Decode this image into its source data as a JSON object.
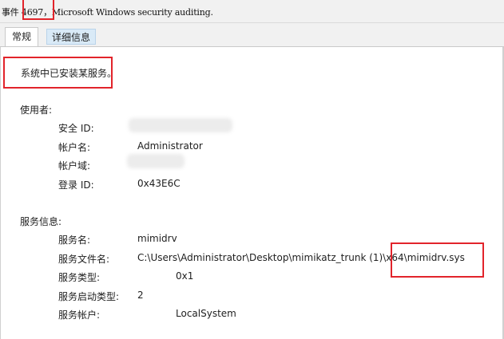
{
  "window": {
    "title": "事件 4697，Microsoft Windows security auditing."
  },
  "tabs": [
    {
      "label": "常规"
    },
    {
      "label": "详细信息"
    }
  ],
  "description": "系统中已安装某服务。",
  "user_section": {
    "heading": "使用者:",
    "fields": [
      {
        "label": "安全 ID:",
        "value": ""
      },
      {
        "label": "帐户名:",
        "value": "Administrator"
      },
      {
        "label": "帐户域:",
        "value": ""
      },
      {
        "label": "登录 ID:",
        "value": "0x43E6C"
      }
    ]
  },
  "service_section": {
    "heading": "服务信息:",
    "fields": [
      {
        "label": "服务名:",
        "value": "mimidrv"
      },
      {
        "label": "服务文件名:",
        "value": "C:\\Users\\Administrator\\Desktop\\mimikatz_trunk (1)\\x64\\mimidrv.sys"
      },
      {
        "label": "服务类型:",
        "value": "0x1"
      },
      {
        "label": "服务启动类型:",
        "value": "2"
      },
      {
        "label": "服务帐户:",
        "value": "LocalSystem"
      }
    ]
  },
  "highlight_color": "#e2242b"
}
